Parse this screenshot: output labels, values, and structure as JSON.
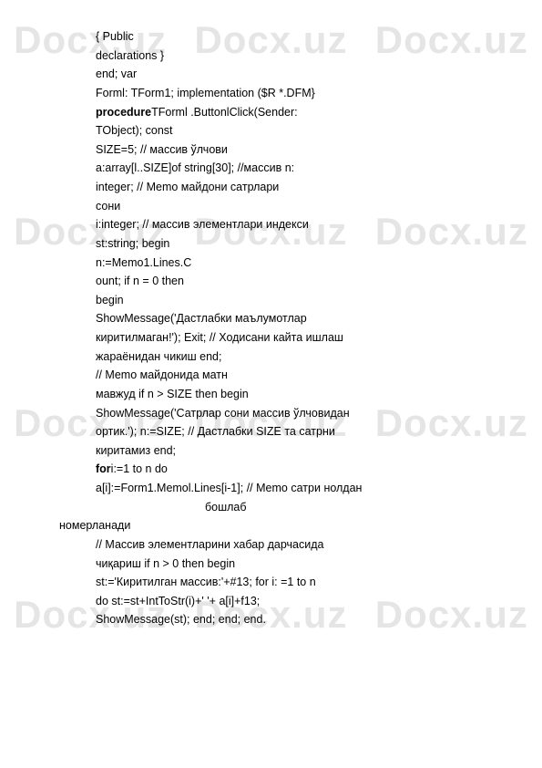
{
  "watermark": "Docx.uz",
  "lines": [
    "{ Public",
    "declarations }",
    "end; var",
    "Forml: TForm1; implementation ($R *.DFM}",
    "procedureTForml .ButtonlClick(Sender:",
    "TObject); const",
    "SIZE=5; // массив ўлчови",
    "a:array[l..SIZE]of string[30]; //массив n:",
    "integer; // Memo майдони сатрлари",
    "сони",
    "i:integer; // массив элементлари индекси",
    "st:string; begin",
    "n:=Memo1.Lines.C",
    "ount; if n = 0 then",
    "begin",
    "ShowMessage('Дастлабки маълумотлар",
    "киритилмаган!'); Exit; // Ходисани кайта ишлаш",
    "жараёнидан чикиш end;",
    "// Memo майдонида матн",
    "мавжуд if n > SIZE then begin",
    "ShowMessage('Сатрлар сони массив ўлчовидан",
    "ортик.'); n:=SIZE; // Дастлабки SIZE та сатрни",
    "киритамиз end;",
    "fori:=1 to n do"
  ],
  "special": {
    "left": "a[i]:=Form1.Memol.Lines[i-1];",
    "mid1": "//",
    "mid2": "Memo",
    "mid3": "сатри",
    "right": "нолдан",
    "indent": "бошлаб",
    "outdent": "номерланади"
  },
  "lines2": [
    "// Массив элементларини хабар дарчасида",
    "чиқариш if n > 0 then begin",
    "st:='Киритилган массив:'+#13; for i: =1 to n"
  ],
  "spaced": {
    "w1": "do",
    "w2": "st:=st+IntToStr(i)+'",
    "w3": "'+",
    "w4": "a[i]+f13;"
  },
  "lastline": "ShowMessage(st); end; end; end."
}
